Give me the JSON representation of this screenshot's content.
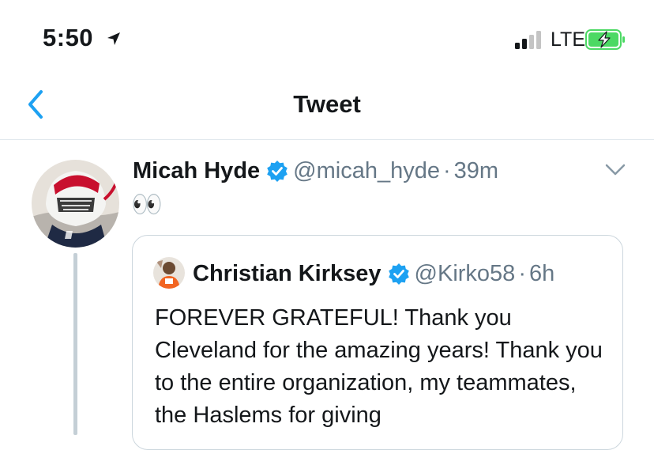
{
  "status_bar": {
    "time": "5:50",
    "carrier": "LTE",
    "location_icon": "location-arrow-icon",
    "signal_icon": "cellular-signal-icon",
    "battery_icon": "battery-charging-icon"
  },
  "nav": {
    "title": "Tweet",
    "back_icon": "chevron-left-icon"
  },
  "tweet": {
    "author_name": "Micah Hyde",
    "handle": "@micah_hyde",
    "separator": "·",
    "time_ago": "39m",
    "text": "👀",
    "avatar_icon": "avatar",
    "menu_icon": "chevron-down-icon"
  },
  "quote": {
    "author_name": "Christian Kirksey",
    "handle": "@Kirko58",
    "separator": "·",
    "time_ago": "6h",
    "text": "FOREVER GRATEFUL! Thank you Cleveland for the amazing years! Thank you to the entire organization, my teammates, the Haslems for giving"
  },
  "colors": {
    "accent": "#1da1f2",
    "secondary_text": "#657786",
    "border": "#e1e8ed",
    "battery_green": "#4cd964"
  }
}
